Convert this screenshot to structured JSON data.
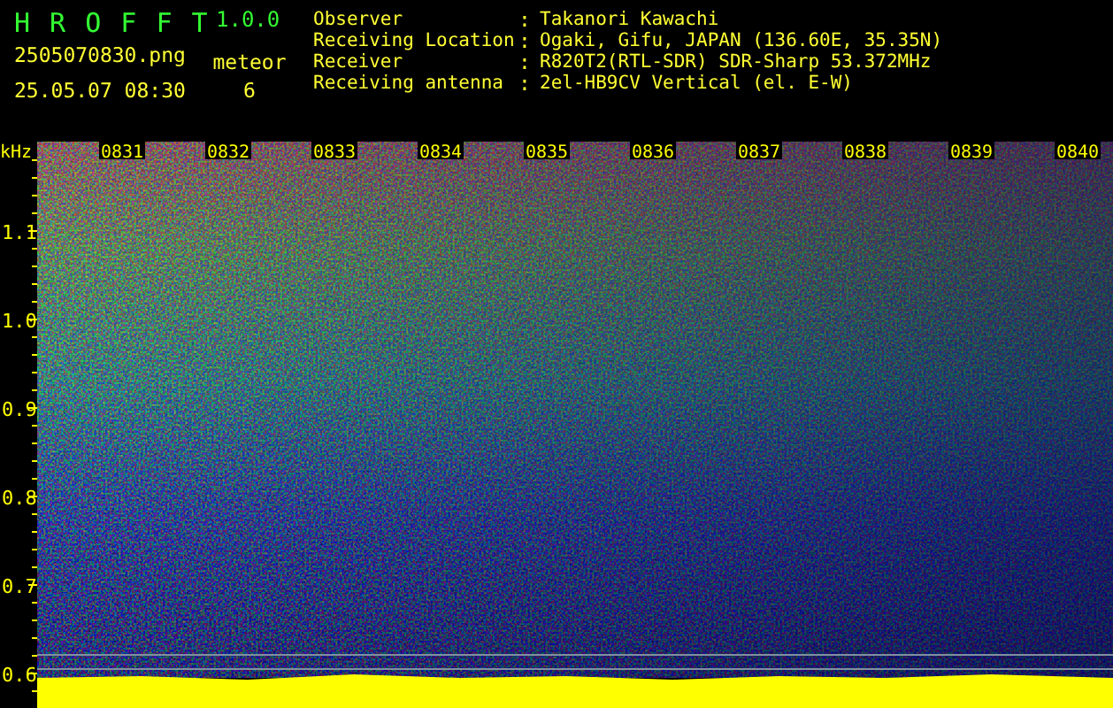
{
  "app": {
    "name": "H R O F F T",
    "version": "1.0.0"
  },
  "file": {
    "filename": "2505070830.png",
    "datetime": "25.05.07 08:30",
    "count_label": "meteor",
    "count": "6"
  },
  "station": [
    {
      "label": "Observer",
      "separator": ":",
      "value": "Takanori Kawachi"
    },
    {
      "label": "Receiving Location",
      "separator": ":",
      "value": "Ogaki, Gifu, JAPAN (136.60E, 35.35N)"
    },
    {
      "label": "Receiver",
      "separator": ":",
      "value": "R820T2(RTL-SDR) SDR-Sharp 53.372MHz"
    },
    {
      "label": "Receiving antenna",
      "separator": ":",
      "value": "2el-HB9CV Vertical (el. E-W)"
    }
  ],
  "plot": {
    "unit": "kHz",
    "y_labels": [
      "1.1",
      "1.0",
      "0.9",
      "0.8",
      "0.7",
      "0.6"
    ],
    "time_labels": [
      "0831",
      "0832",
      "0833",
      "0834",
      "0835",
      "0836",
      "0837",
      "0838",
      "0839",
      "0840"
    ]
  }
}
